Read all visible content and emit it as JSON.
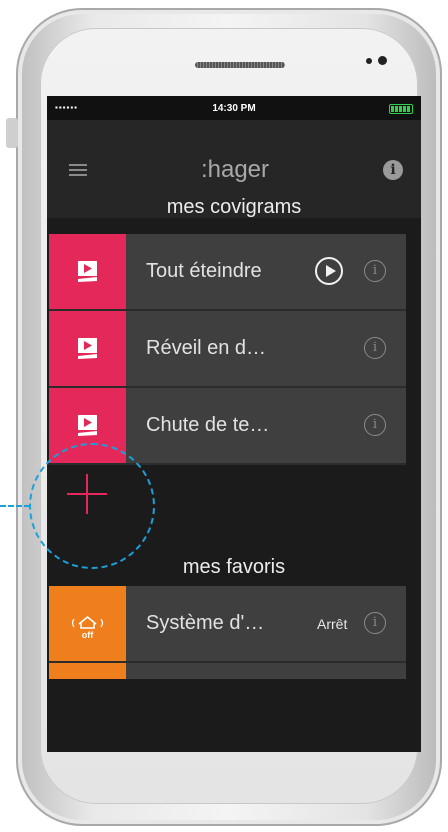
{
  "statusbar": {
    "signal": "▪▪▪▪▪▪",
    "time": "14:30 PM"
  },
  "appbar": {
    "logo": ":hager",
    "info_glyph": "i"
  },
  "covigrams": {
    "title": "mes covigrams",
    "items": [
      {
        "label": "Tout éteindre",
        "info_glyph": "i"
      },
      {
        "label": "Réveil en d…",
        "info_glyph": "i"
      },
      {
        "label": "Chute de te…",
        "info_glyph": "i"
      }
    ]
  },
  "favoris": {
    "title": "mes favoris",
    "items": [
      {
        "label": "Système d'…",
        "state": "Arrêt",
        "badge": "off",
        "info_glyph": "i"
      }
    ]
  },
  "colors": {
    "pink": "#e4285a",
    "orange": "#ee7f1c",
    "highlight": "#1ba0dc"
  },
  "icons": [
    "menu-icon",
    "info-icon",
    "play-icon",
    "add-icon",
    "alarm-off-icon",
    "scenario-icon"
  ]
}
